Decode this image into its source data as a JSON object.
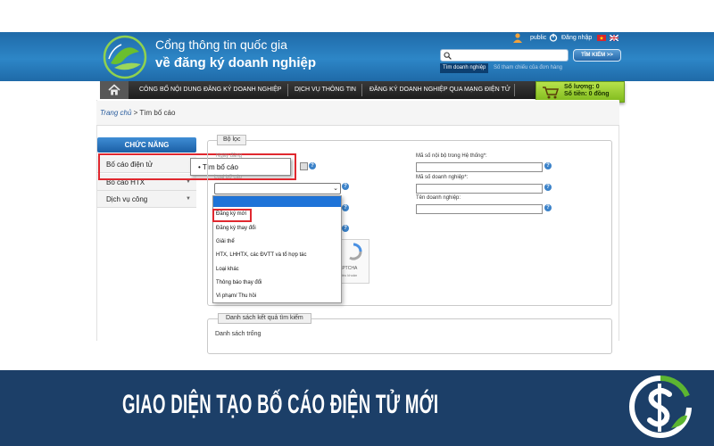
{
  "header": {
    "site_title_line1": "Cổng thông tin quốc gia",
    "site_title_line2": "về đăng ký doanh nghiệp",
    "user_label": "public",
    "login_label": "Đăng nhập",
    "search": {
      "value": "",
      "button_label": "TÌM KIẾM >>",
      "tabs": [
        "Tìm doanh nghiệp",
        "Số tham chiếu của đơn hàng"
      ]
    }
  },
  "nav": {
    "items": [
      "CÔNG BỐ NỘI DUNG ĐĂNG KÝ DOANH NGHIỆP",
      "DỊCH VỤ THÔNG TIN",
      "ĐĂNG KÝ DOANH NGHIỆP QUA MẠNG ĐIỆN TỬ"
    ],
    "cart": {
      "quantity_label": "Số lượng: 0",
      "amount_label": "Số tiền: 0 đồng"
    }
  },
  "breadcrumb": {
    "home": "Trang chủ",
    "separator": ">",
    "current": "Tìm bố cáo"
  },
  "sidebar": {
    "header": "CHỨC NĂNG",
    "items": [
      "Bố cáo điện tử",
      "Bố cáo HTX",
      "Dịch vụ công"
    ],
    "flyout_item": "Tìm bố cáo"
  },
  "filter": {
    "legend": "Bộ lọc",
    "date_label": "Ngày đăng",
    "type_label": "Loại bố cáo",
    "internal_id_label": "Mã số nội bộ trong Hệ thống*:",
    "enterprise_code_label": "Mã số doanh nghiệp*:",
    "enterprise_name_label": "Tên doanh nghiệp:",
    "type_options": [
      "",
      "Đăng ký mới",
      "Đăng ký thay đổi",
      "Giải thể",
      "HTX, LHHTX, các ĐVTT và tổ hợp tác",
      "Loại khác",
      "Thông báo thay đổi",
      "Vi phạm/ Thu hồi"
    ],
    "captcha_label": "APTCHA",
    "captcha_terms": "Điều khoản"
  },
  "results": {
    "legend": "Danh sách kết quả tìm kiếm",
    "empty_text": "Danh sách trống"
  },
  "banner": {
    "title": "GIAO DIỆN TẠO BỐ CÁO ĐIỆN TỬ MỚI"
  },
  "colors": {
    "header_blue": "#2d86c7",
    "nav_dark": "#2a2a2a",
    "banner_navy": "#1c3f68",
    "cart_green": "#9ccf2f",
    "highlight_red": "#e0282f",
    "brand_green": "#5cb531"
  },
  "icons": [
    "logo-leaf-icon",
    "user-icon",
    "power-icon",
    "vietnam-flag-icon",
    "uk-flag-icon",
    "search-icon",
    "home-icon",
    "cart-icon",
    "calendar-icon",
    "help-icon",
    "chevron-down-icon",
    "dollar-brand-icon"
  ]
}
